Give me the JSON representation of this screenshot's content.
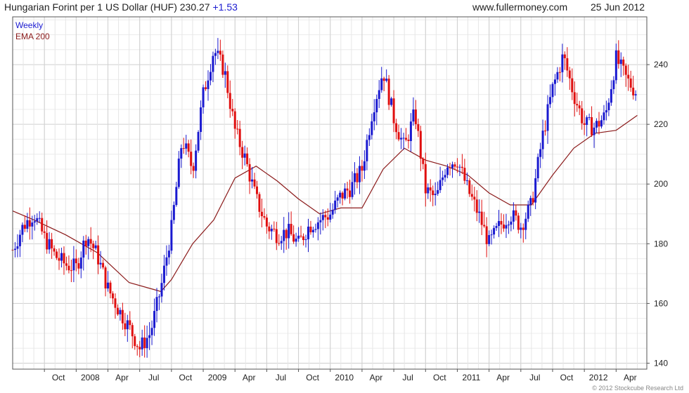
{
  "header": {
    "instrument": "Hungarian Forint per 1 US Dollar (HUF)",
    "last": "230.27",
    "change": "+1.53",
    "site": "www.fullermoney.com",
    "date": "25 Jun 2012"
  },
  "footer": {
    "credit": "© 2012 Stockcube Research Ltd"
  },
  "colors": {
    "up": "#1a1ad0",
    "down": "#e01010",
    "ema": "#8b1a1a",
    "grid": "#d8d8d8"
  },
  "chart_data": {
    "type": "line",
    "title": "Hungarian Forint per 1 US Dollar (HUF)",
    "legend": [
      "Weekly",
      "EMA 200"
    ],
    "legend_position": "top-left",
    "grid": true,
    "ylim": [
      138,
      256
    ],
    "y_ticks": [
      140,
      160,
      180,
      200,
      220,
      240
    ],
    "x_ticks": [
      "Oct",
      "2008",
      "Apr",
      "Jul",
      "Oct",
      "2009",
      "Apr",
      "Jul",
      "Oct",
      "2010",
      "Apr",
      "Jul",
      "Oct",
      "2011",
      "Apr",
      "Jul",
      "Oct",
      "2012",
      "Apr"
    ],
    "x_range": [
      "2007-07",
      "2012-06"
    ],
    "series": [
      {
        "name": "Weekly",
        "x": [
          "2007-07",
          "2007-08",
          "2007-09",
          "2007-10",
          "2007-11",
          "2007-12",
          "2008-01",
          "2008-02",
          "2008-03",
          "2008-04",
          "2008-05",
          "2008-06",
          "2008-07",
          "2008-08",
          "2008-09",
          "2008-10",
          "2008-11",
          "2008-12",
          "2009-01",
          "2009-02",
          "2009-03",
          "2009-04",
          "2009-05",
          "2009-06",
          "2009-07",
          "2009-08",
          "2009-09",
          "2009-10",
          "2009-11",
          "2009-12",
          "2010-01",
          "2010-02",
          "2010-03",
          "2010-04",
          "2010-05",
          "2010-06",
          "2010-07",
          "2010-08",
          "2010-09",
          "2010-10",
          "2010-11",
          "2010-12",
          "2011-01",
          "2011-02",
          "2011-03",
          "2011-04",
          "2011-05",
          "2011-06",
          "2011-07",
          "2011-08",
          "2011-09",
          "2011-10",
          "2011-11",
          "2011-12",
          "2012-01",
          "2012-02",
          "2012-03",
          "2012-04",
          "2012-05",
          "2012-06"
        ],
        "values": [
          178,
          186,
          190,
          182,
          176,
          173,
          172,
          183,
          176,
          165,
          158,
          152,
          145,
          150,
          165,
          185,
          215,
          205,
          230,
          245,
          238,
          218,
          208,
          195,
          186,
          183,
          184,
          180,
          186,
          188,
          190,
          196,
          199,
          205,
          225,
          238,
          222,
          212,
          224,
          198,
          195,
          207,
          208,
          198,
          190,
          180,
          186,
          190,
          186,
          193,
          215,
          232,
          243,
          230,
          220,
          219,
          223,
          242,
          235,
          230.27
        ]
      },
      {
        "name": "EMA 200",
        "x": [
          "2007-07",
          "2007-09",
          "2007-12",
          "2008-03",
          "2008-06",
          "2008-09",
          "2008-10",
          "2008-12",
          "2009-02",
          "2009-04",
          "2009-06",
          "2009-08",
          "2009-10",
          "2009-12",
          "2010-02",
          "2010-04",
          "2010-06",
          "2010-08",
          "2010-10",
          "2010-12",
          "2011-02",
          "2011-04",
          "2011-06",
          "2011-08",
          "2011-10",
          "2011-12",
          "2012-02",
          "2012-04",
          "2012-06"
        ],
        "values": [
          191,
          188,
          183,
          177,
          167,
          164,
          168,
          180,
          188,
          202,
          206,
          201,
          195,
          190,
          192,
          192,
          205,
          212,
          208,
          206,
          203,
          197,
          193,
          193,
          203,
          212,
          217,
          218,
          223
        ]
      }
    ]
  }
}
